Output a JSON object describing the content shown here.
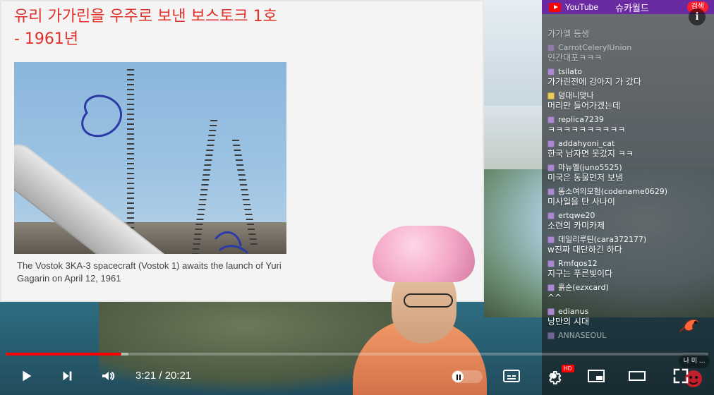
{
  "slide": {
    "title": "유리 가가린을 우주로 보낸 보스토크 1호\n- 1961년",
    "caption": "The Vostok 3KA-3 spacecraft (Vostok 1) awaits the launch of Yuri Gagarin on April 12, 1961"
  },
  "chat_header": {
    "youtube_label": "YouTube",
    "channel_name": "슈카월드",
    "live_badge": "검색"
  },
  "chat": {
    "messages": [
      {
        "user": "",
        "text": "가가멜 등생",
        "dim": true
      },
      {
        "user": "CarrotCelerylUnion",
        "text": "인간대포ㅋㅋㅋ",
        "dim": true
      },
      {
        "user": "tsilato",
        "text": "가가린전에 강아지 가 갔다",
        "dim": false
      },
      {
        "user": "덩대니맞나",
        "text": "머리만 들어가겠는데",
        "dim": false
      },
      {
        "user": "replica7239",
        "text": "ㅋㅋㅋㅋㅋㅋㅋㅋㅋㅋ",
        "dim": false
      },
      {
        "user": "addahyoni_cat",
        "text": "한국 남자면 못갔지 ㅋㅋ",
        "dim": false
      },
      {
        "user": "마뉴엘(juno5525)",
        "text": "미국은 동물먼저 보냄",
        "dim": false
      },
      {
        "user": "똥소여의모험(codename0629)",
        "text": "미사일을 탄 사나이",
        "dim": false
      },
      {
        "user": "ertqwe20",
        "text": "소련의 카미카제",
        "dim": false
      },
      {
        "user": "데일리루틴(cara372177)",
        "text": "w진짜 대단하긴 하다",
        "dim": false
      },
      {
        "user": "Rmfqos12",
        "text": "지구는 푸른빛이다",
        "dim": false
      },
      {
        "user": "흙순(ezxcard)",
        "text": "^^",
        "dim": false
      },
      {
        "user": "edianus",
        "text": "낭만의 시대",
        "dim": false
      },
      {
        "user": "ANNASEOUL",
        "text": "",
        "dim": true
      }
    ]
  },
  "player": {
    "time_current": "3:21",
    "time_total": "20:21",
    "progress_fraction": 0.165,
    "buffer_fraction": 0.175,
    "hd_label": "HD",
    "corner_bubble": "나 미 ..."
  },
  "colors": {
    "progress_red": "#ff0000",
    "header_purple": "#6a2ba2",
    "slide_title_red": "#e0312b"
  },
  "icons": {
    "play": "play-icon",
    "next": "next-icon",
    "volume": "volume-icon",
    "settings": "settings-icon",
    "miniplayer": "miniplayer-icon",
    "theater": "theater-icon",
    "fullscreen": "fullscreen-icon",
    "captions": "captions-icon",
    "info": "info-icon"
  }
}
